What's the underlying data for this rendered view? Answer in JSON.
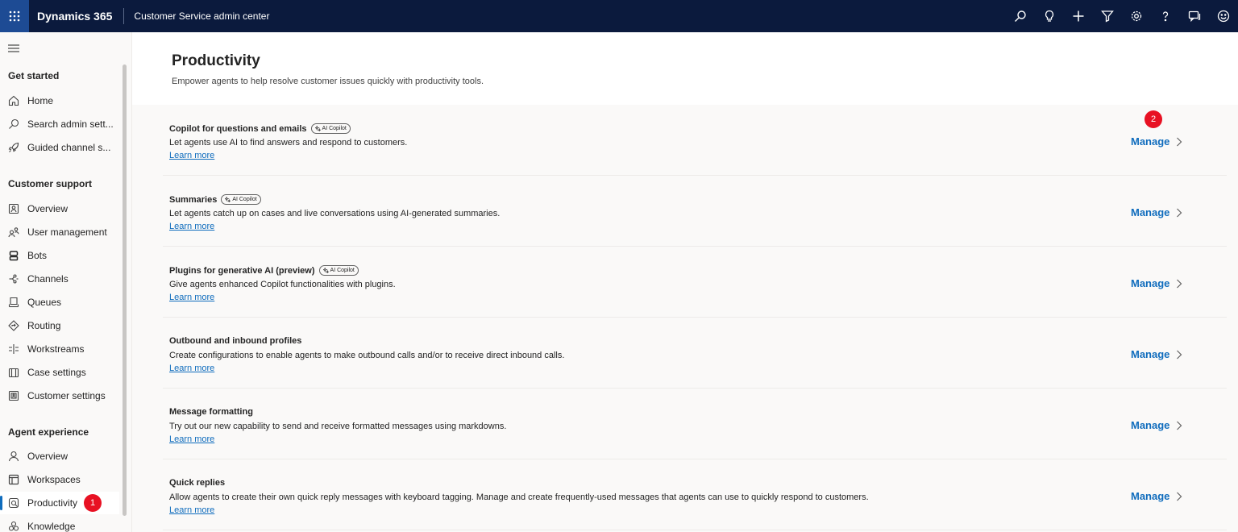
{
  "topbar": {
    "brand": "Dynamics 365",
    "app_name": "Customer Service admin center",
    "icons": [
      "search-icon",
      "lightbulb-icon",
      "plus-icon",
      "filter-icon",
      "gear-icon",
      "help-icon",
      "chat-icon",
      "smiley-icon"
    ],
    "background": "#0b1a3d"
  },
  "sidebar": {
    "sections": [
      {
        "title": "Get started",
        "items": [
          {
            "label": "Home",
            "icon": "home-icon"
          },
          {
            "label": "Search admin sett...",
            "icon": "search-icon"
          },
          {
            "label": "Guided channel s...",
            "icon": "rocket-icon"
          }
        ]
      },
      {
        "title": "Customer support",
        "items": [
          {
            "label": "Overview",
            "icon": "overview-icon"
          },
          {
            "label": "User management",
            "icon": "users-icon"
          },
          {
            "label": "Bots",
            "icon": "bot-icon"
          },
          {
            "label": "Channels",
            "icon": "channels-icon"
          },
          {
            "label": "Queues",
            "icon": "queue-icon"
          },
          {
            "label": "Routing",
            "icon": "routing-icon"
          },
          {
            "label": "Workstreams",
            "icon": "workstreams-icon"
          },
          {
            "label": "Case settings",
            "icon": "case-icon"
          },
          {
            "label": "Customer settings",
            "icon": "customer-icon"
          }
        ]
      },
      {
        "title": "Agent experience",
        "items": [
          {
            "label": "Overview",
            "icon": "person-icon"
          },
          {
            "label": "Workspaces",
            "icon": "workspace-icon"
          },
          {
            "label": "Productivity",
            "icon": "productivity-icon",
            "selected": true,
            "badge": "1"
          },
          {
            "label": "Knowledge",
            "icon": "knowledge-icon"
          }
        ]
      }
    ]
  },
  "main": {
    "title": "Productivity",
    "description": "Empower agents to help resolve customer issues quickly with productivity tools.",
    "copilot_tag": "AI Copilot",
    "learn_more": "Learn more",
    "manage_label": "Manage",
    "annotation_badge": "2",
    "cards": [
      {
        "title": "Copilot for questions and emails",
        "copilot": true,
        "description": "Let agents use AI to find answers and respond to customers."
      },
      {
        "title": "Summaries",
        "copilot": true,
        "description": "Let agents catch up on cases and live conversations using AI-generated summaries."
      },
      {
        "title": "Plugins for generative AI (preview)",
        "copilot": true,
        "description": "Give agents enhanced Copilot functionalities with plugins."
      },
      {
        "title": "Outbound and inbound profiles",
        "copilot": false,
        "description": "Create configurations to enable agents to make outbound calls and/or to receive direct inbound calls."
      },
      {
        "title": "Message formatting",
        "copilot": false,
        "description": "Try out our new capability to send and receive formatted messages using markdowns."
      },
      {
        "title": "Quick replies",
        "copilot": false,
        "description": "Allow agents to create their own quick reply messages with keyboard tagging. Manage and create frequently-used messages that agents can use to quickly respond to customers."
      }
    ]
  },
  "colors": {
    "accent": "#0f6cbd",
    "badge": "#e81123"
  }
}
